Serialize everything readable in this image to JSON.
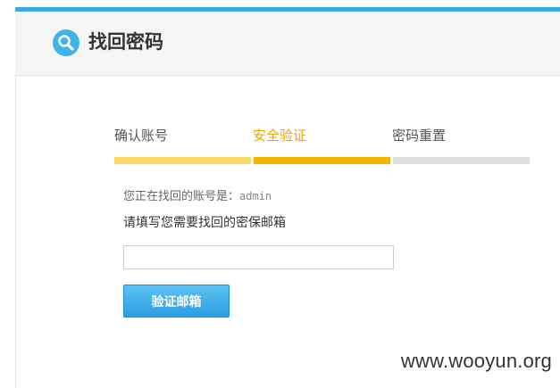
{
  "header": {
    "title": "找回密码",
    "icon": "search-icon"
  },
  "steps": [
    {
      "label": "确认账号",
      "status": "done"
    },
    {
      "label": "安全验证",
      "status": "active"
    },
    {
      "label": "密码重置",
      "status": "todo"
    }
  ],
  "colors": {
    "accent": "#39a9e6",
    "step_done": "#f8d866",
    "step_active": "#f4b400",
    "step_todo": "#e0e0e0",
    "active_text": "#f0a400",
    "button": "#2c9fe0"
  },
  "form": {
    "account_prefix": "您正在找回的账号是：",
    "account_name": "admin",
    "prompt": "请填写您需要找回的密保邮箱",
    "email_value": "",
    "submit_label": "验证邮箱"
  },
  "watermark": "www.wooyun.org"
}
